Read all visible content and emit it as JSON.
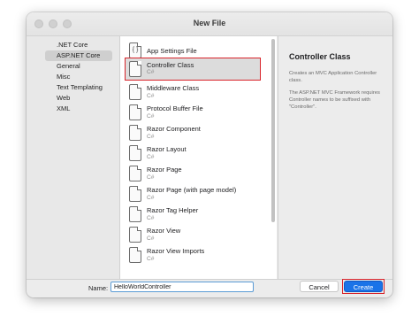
{
  "window": {
    "title": "New File"
  },
  "categories": [
    {
      "label": ".NET Core",
      "selected": false
    },
    {
      "label": "ASP.NET Core",
      "selected": true
    },
    {
      "label": "General",
      "selected": false
    },
    {
      "label": "Misc",
      "selected": false
    },
    {
      "label": "Text Templating",
      "selected": false
    },
    {
      "label": "Web",
      "selected": false
    },
    {
      "label": "XML",
      "selected": false
    }
  ],
  "templates": [
    {
      "label": "App Settings File",
      "sub": "",
      "icon": "json-file-icon"
    },
    {
      "label": "Controller Class",
      "sub": "C#",
      "icon": "csharp-file-icon",
      "selected": true
    },
    {
      "label": "Middleware Class",
      "sub": "C#",
      "icon": "csharp-file-icon"
    },
    {
      "label": "Protocol Buffer File",
      "sub": "C#",
      "icon": "csharp-file-icon"
    },
    {
      "label": "Razor Component",
      "sub": "C#",
      "icon": "csharp-file-icon"
    },
    {
      "label": "Razor Layout",
      "sub": "C#",
      "icon": "csharp-file-icon"
    },
    {
      "label": "Razor Page",
      "sub": "C#",
      "icon": "csharp-file-icon"
    },
    {
      "label": "Razor Page (with page model)",
      "sub": "C#",
      "icon": "csharp-file-icon"
    },
    {
      "label": "Razor Tag Helper",
      "sub": "C#",
      "icon": "csharp-file-icon"
    },
    {
      "label": "Razor View",
      "sub": "C#",
      "icon": "csharp-file-icon"
    },
    {
      "label": "Razor View Imports",
      "sub": "C#",
      "icon": "csharp-file-icon"
    }
  ],
  "description": {
    "title": "Controller Class",
    "line1": "Creates an MVC Application Controller class.",
    "line2": "The ASP.NET MVC Framework requires Controller names to be suffixed with \"Controller\"."
  },
  "footer": {
    "name_label": "Name:",
    "name_value": "HelloWorldController",
    "cancel_label": "Cancel",
    "create_label": "Create"
  },
  "colors": {
    "accent": "#1a73e8",
    "highlight": "#d8232a"
  }
}
